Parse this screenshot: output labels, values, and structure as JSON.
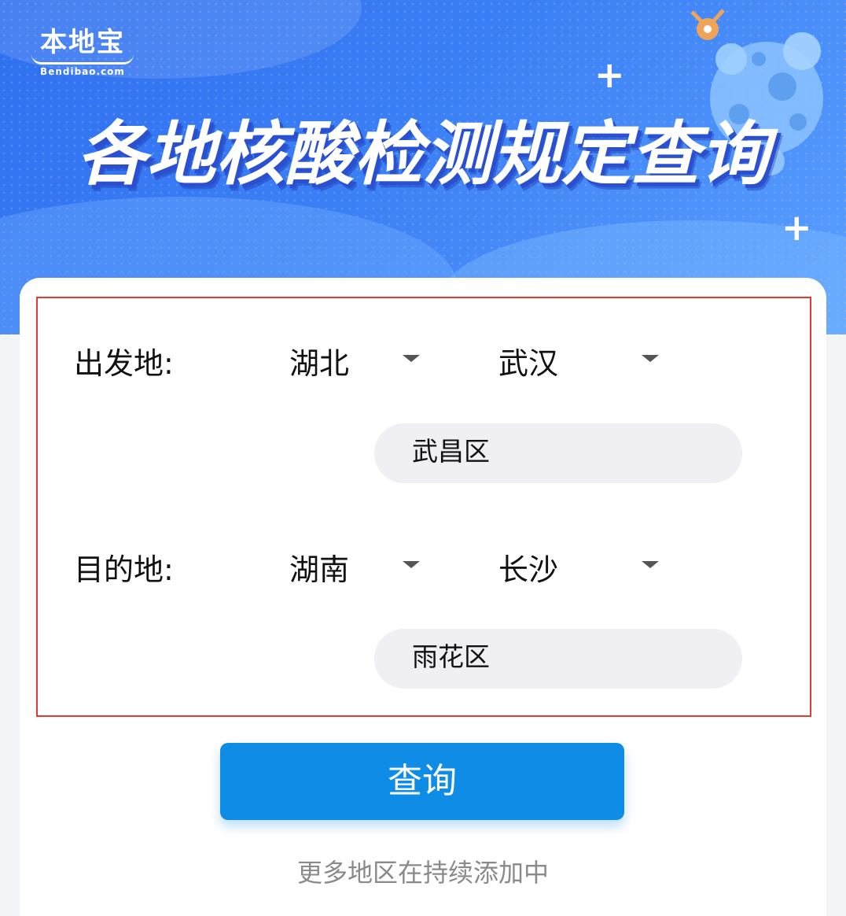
{
  "banner": {
    "logo_cn": "本地宝",
    "logo_en": "Bendibao.com",
    "title": "各地核酸检测规定查询"
  },
  "form": {
    "origin": {
      "label": "出发地:",
      "province": "湖北",
      "city": "武汉",
      "district": "武昌区"
    },
    "destination": {
      "label": "目的地:",
      "province": "湖南",
      "city": "长沙",
      "district": "雨花区"
    }
  },
  "actions": {
    "query_label": "查询"
  },
  "footer": {
    "note": "更多地区在持续添加中"
  },
  "colors": {
    "accent": "#0f8de6",
    "highlight_border": "#e53935",
    "banner": "#3b7ff5"
  }
}
